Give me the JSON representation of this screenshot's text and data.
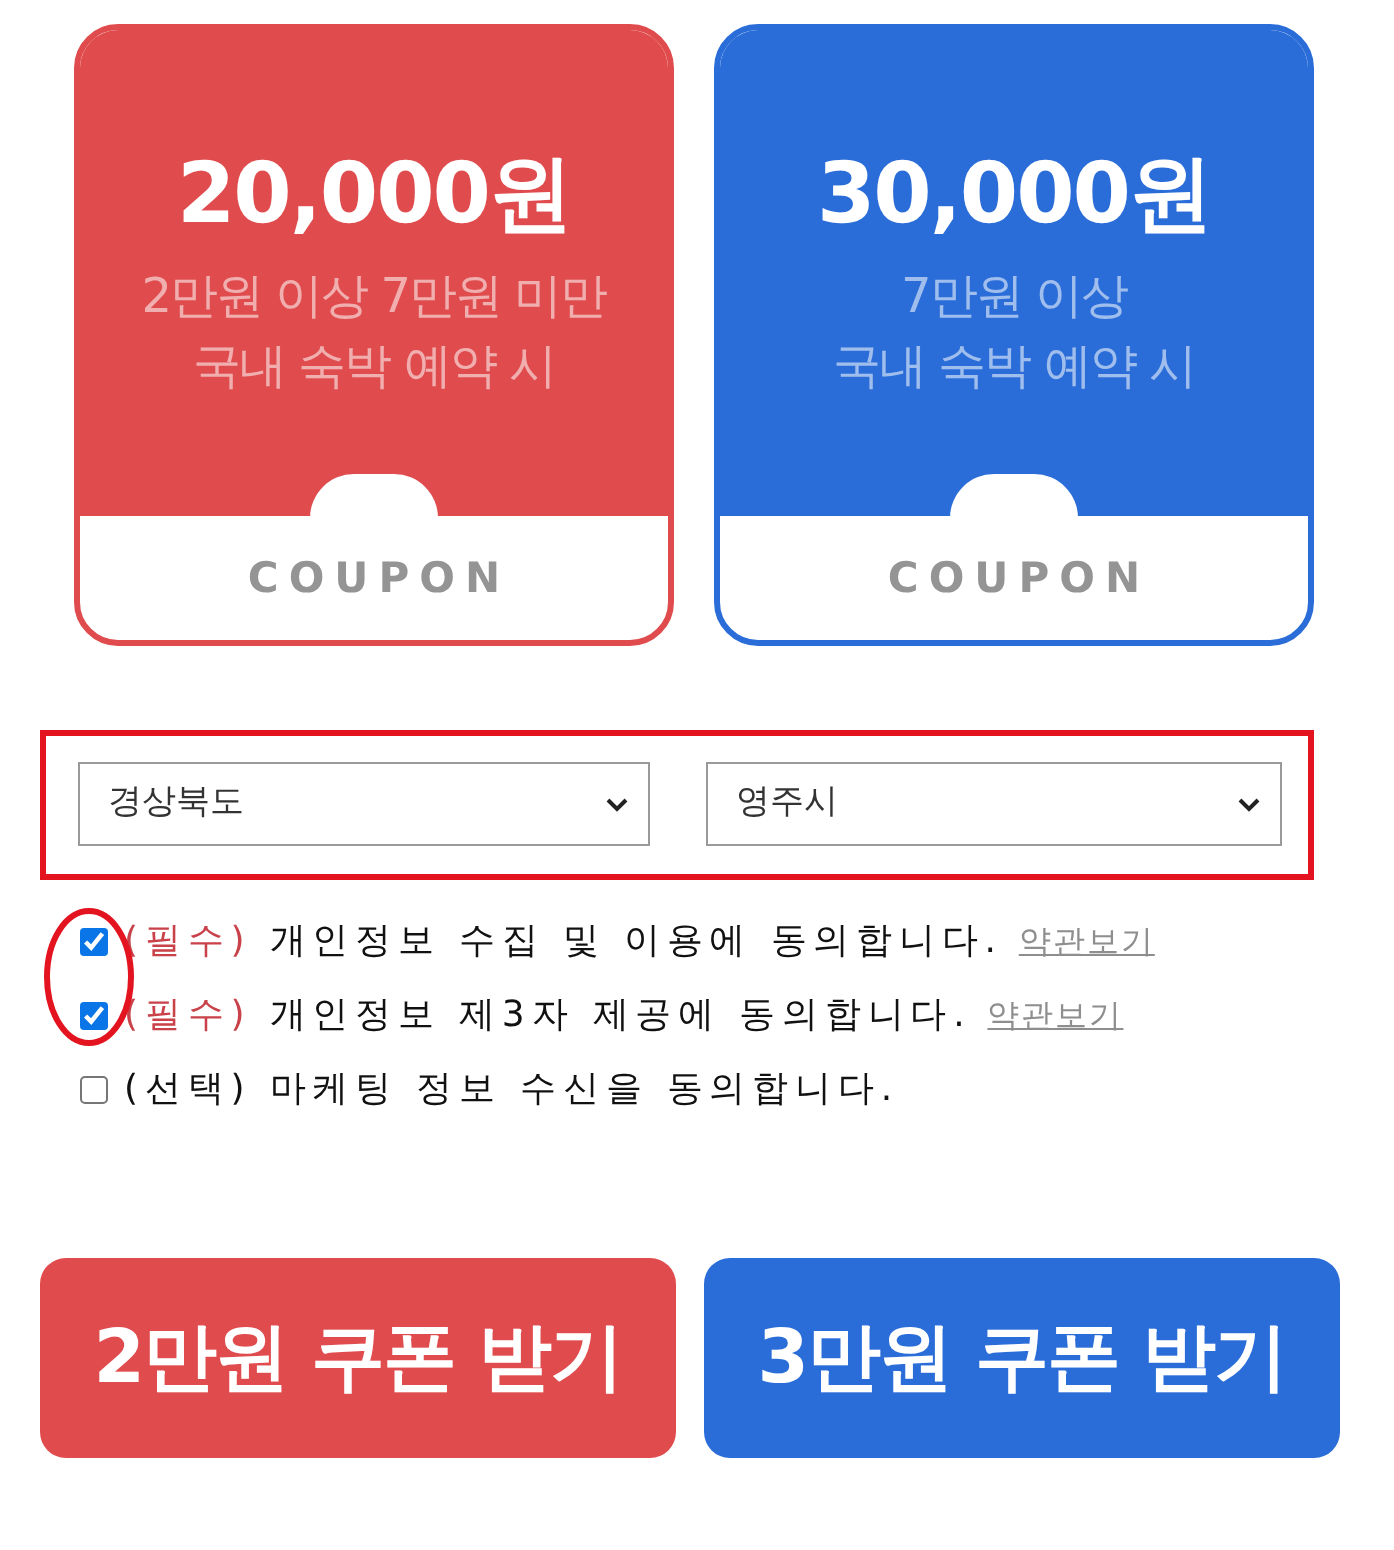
{
  "coupons": [
    {
      "amount": "20,000원",
      "condition_lines": [
        "2만원 이상 7만원 미만",
        "국내 숙박 예약 시"
      ],
      "label": "COUPON",
      "color": "#e04c4e"
    },
    {
      "amount": "30,000원",
      "condition_lines": [
        "7만원 이상",
        "국내 숙박 예약 시"
      ],
      "label": "COUPON",
      "color": "#2a6dd8"
    }
  ],
  "region": {
    "highlighted": true,
    "selects": [
      {
        "value": "경상북도"
      },
      {
        "value": "영주시"
      }
    ]
  },
  "agreements": {
    "checkboxes_circled": true,
    "items": [
      {
        "tag": "(필수)",
        "text": "개인정보 수집 및 이용에 동의합니다.",
        "link": "약관보기",
        "required": true,
        "checked": true
      },
      {
        "tag": "(필수)",
        "text": "개인정보 제3자 제공에 동의합니다.",
        "link": "약관보기",
        "required": true,
        "checked": true
      },
      {
        "tag": "(선택)",
        "text": "마케팅 정보 수신을 동의합니다.",
        "required": false,
        "checked": false
      }
    ]
  },
  "buttons": [
    {
      "label": "2만원 쿠폰 받기",
      "color": "#e04c4e"
    },
    {
      "label": "3만원 쿠폰 받기",
      "color": "#2a6dd8"
    }
  ]
}
